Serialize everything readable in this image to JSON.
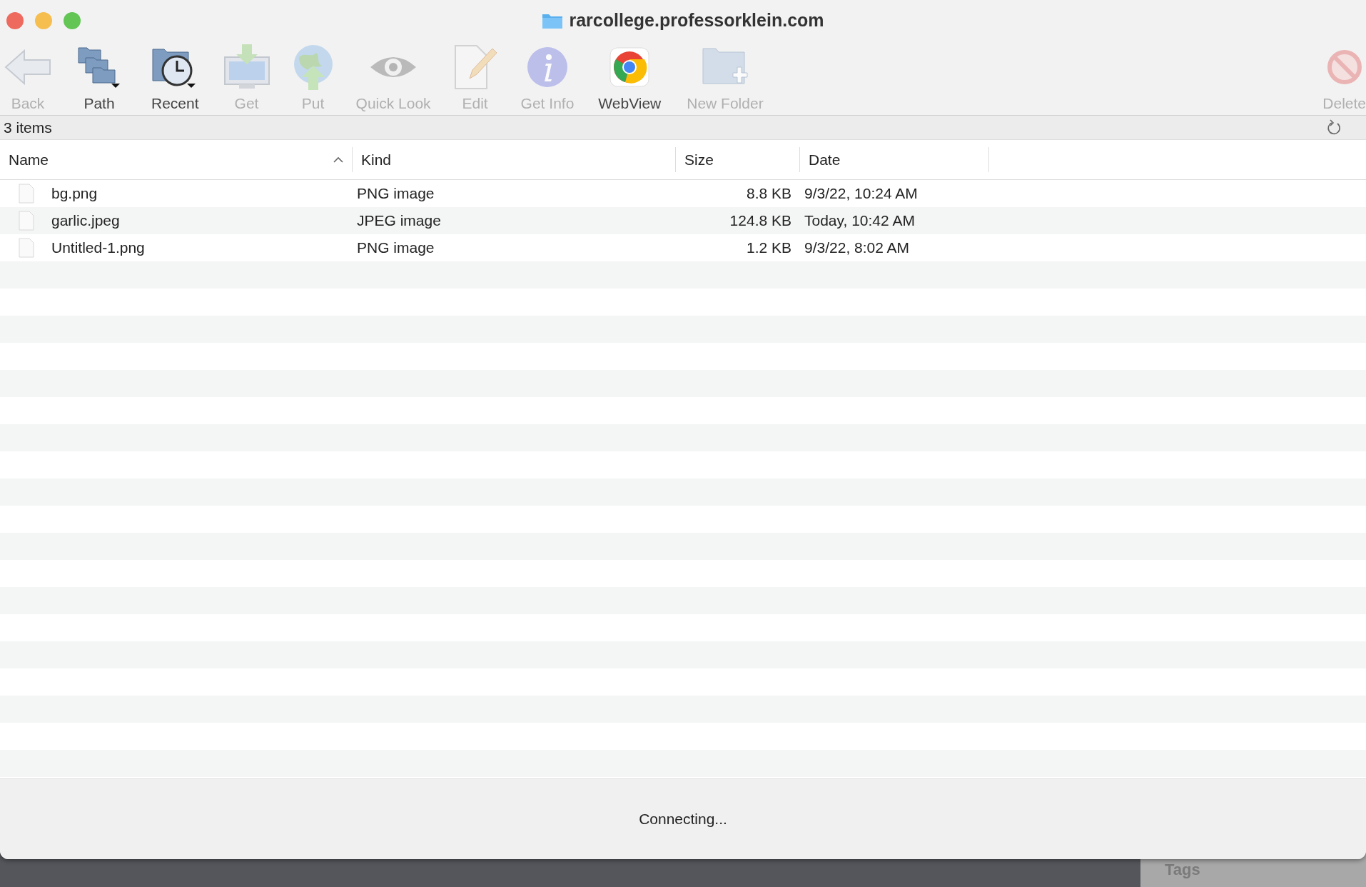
{
  "window": {
    "title": "rarcollege.professorklein.com"
  },
  "toolbar": [
    {
      "label": "Back",
      "disabled": true
    },
    {
      "label": "Path",
      "disabled": false
    },
    {
      "label": "Recent",
      "disabled": false
    },
    {
      "label": "Get",
      "disabled": true
    },
    {
      "label": "Put",
      "disabled": true
    },
    {
      "label": "Quick Look",
      "disabled": true
    },
    {
      "label": "Edit",
      "disabled": true
    },
    {
      "label": "Get Info",
      "disabled": true
    },
    {
      "label": "WebView",
      "disabled": false
    },
    {
      "label": "New Folder",
      "disabled": true
    },
    {
      "label": "Delete",
      "disabled": true
    }
  ],
  "status": "3 items",
  "table": {
    "columns": [
      {
        "label": "Name",
        "sorted": true
      },
      {
        "label": "Kind",
        "sorted": false
      },
      {
        "label": "Size",
        "sorted": false
      },
      {
        "label": "Date",
        "sorted": false
      }
    ],
    "rows": [
      {
        "name": "bg.png",
        "kind": "PNG image",
        "size": "8.8 KB",
        "date": "9/3/22, 10:24 AM"
      },
      {
        "name": "garlic.jpeg",
        "kind": "JPEG image",
        "size": "124.8 KB",
        "date": "Today, 10:42 AM"
      },
      {
        "name": "Untitled-1.png",
        "kind": "PNG image",
        "size": "1.2 KB",
        "date": "9/3/22, 8:02 AM"
      }
    ]
  },
  "connection_status": "Connecting...",
  "background_window": {
    "label": "Tags"
  }
}
